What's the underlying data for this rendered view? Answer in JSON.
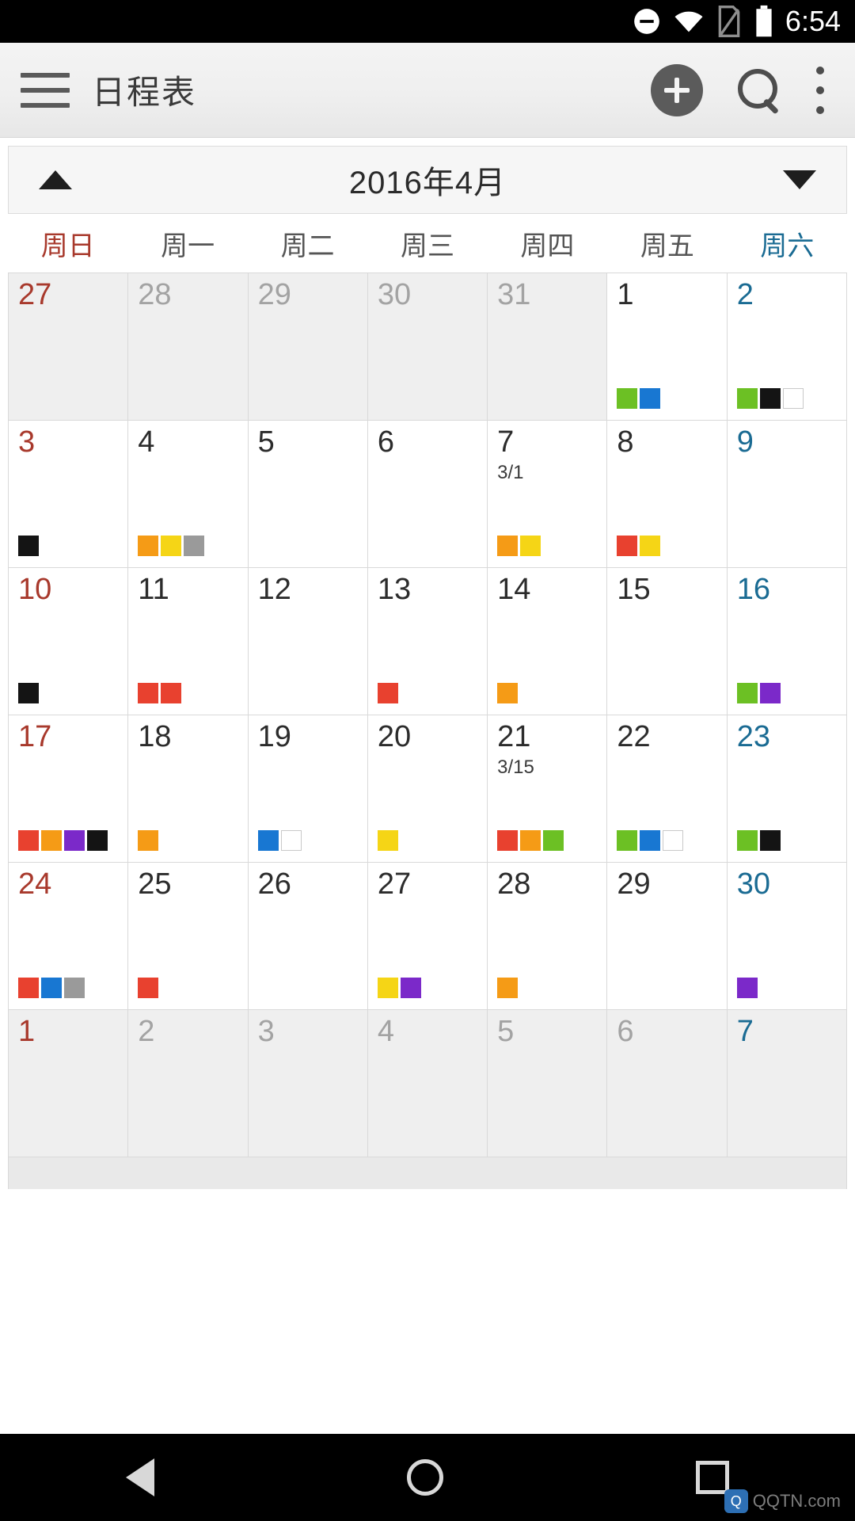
{
  "status_bar": {
    "time": "6:54",
    "icons": [
      "do-not-disturb-icon",
      "wifi-icon",
      "sim-card-icon",
      "battery-icon"
    ]
  },
  "app_bar": {
    "title": "日程表",
    "menu_icon": "hamburger-menu-icon",
    "add_label": "+",
    "search_icon": "search-icon",
    "overflow_icon": "more-vertical-icon"
  },
  "month_switcher": {
    "prev_icon": "triangle-up-icon",
    "next_icon": "triangle-down-icon",
    "label": "2016年4月"
  },
  "weekdays": [
    "周日",
    "周一",
    "周二",
    "周三",
    "周四",
    "周五",
    "周六"
  ],
  "colors": {
    "sunday": "#a8392c",
    "saturday": "#1a6b93",
    "red": "#e8412f",
    "orange": "#f59b16",
    "yellow": "#f5d516",
    "green": "#6cc024",
    "blue": "#1877d2",
    "purple": "#7b29c9",
    "gray": "#9a9a9a",
    "black": "#141414",
    "empty": "#ffffff"
  },
  "weeks": [
    [
      {
        "day": "27",
        "dim": true,
        "chips": []
      },
      {
        "day": "28",
        "dim": true,
        "chips": []
      },
      {
        "day": "29",
        "dim": true,
        "chips": []
      },
      {
        "day": "30",
        "dim": true,
        "chips": []
      },
      {
        "day": "31",
        "dim": true,
        "chips": []
      },
      {
        "day": "1",
        "dim": false,
        "chips": [
          "green",
          "blue"
        ]
      },
      {
        "day": "2",
        "dim": false,
        "chips": [
          "green",
          "black",
          "empty"
        ]
      }
    ],
    [
      {
        "day": "3",
        "dim": false,
        "chips": [
          "black"
        ]
      },
      {
        "day": "4",
        "dim": false,
        "chips": [
          "orange",
          "yellow",
          "gray"
        ]
      },
      {
        "day": "5",
        "dim": false,
        "chips": []
      },
      {
        "day": "6",
        "dim": false,
        "chips": []
      },
      {
        "day": "7",
        "dim": false,
        "lunar": "3/1",
        "chips": [
          "orange",
          "yellow"
        ]
      },
      {
        "day": "8",
        "dim": false,
        "chips": [
          "red",
          "yellow"
        ]
      },
      {
        "day": "9",
        "dim": false,
        "chips": []
      }
    ],
    [
      {
        "day": "10",
        "dim": false,
        "chips": [
          "black"
        ]
      },
      {
        "day": "11",
        "dim": false,
        "chips": [
          "red",
          "red"
        ]
      },
      {
        "day": "12",
        "dim": false,
        "chips": []
      },
      {
        "day": "13",
        "dim": false,
        "chips": [
          "red"
        ]
      },
      {
        "day": "14",
        "dim": false,
        "chips": [
          "orange"
        ]
      },
      {
        "day": "15",
        "dim": false,
        "chips": []
      },
      {
        "day": "16",
        "dim": false,
        "chips": [
          "green",
          "purple"
        ]
      }
    ],
    [
      {
        "day": "17",
        "dim": false,
        "chips": [
          "red",
          "orange",
          "purple",
          "black"
        ]
      },
      {
        "day": "18",
        "dim": false,
        "chips": [
          "orange"
        ]
      },
      {
        "day": "19",
        "dim": false,
        "chips": [
          "blue",
          "empty"
        ]
      },
      {
        "day": "20",
        "dim": false,
        "chips": [
          "yellow"
        ]
      },
      {
        "day": "21",
        "dim": false,
        "lunar": "3/15",
        "chips": [
          "red",
          "orange",
          "green"
        ]
      },
      {
        "day": "22",
        "dim": false,
        "chips": [
          "green",
          "blue",
          "empty"
        ]
      },
      {
        "day": "23",
        "dim": false,
        "chips": [
          "green",
          "black"
        ]
      }
    ],
    [
      {
        "day": "24",
        "dim": false,
        "chips": [
          "red",
          "blue",
          "gray"
        ]
      },
      {
        "day": "25",
        "dim": false,
        "chips": [
          "red"
        ]
      },
      {
        "day": "26",
        "dim": false,
        "chips": []
      },
      {
        "day": "27",
        "dim": false,
        "chips": [
          "yellow",
          "purple"
        ]
      },
      {
        "day": "28",
        "dim": false,
        "chips": [
          "orange"
        ]
      },
      {
        "day": "29",
        "dim": false,
        "chips": []
      },
      {
        "day": "30",
        "dim": false,
        "chips": [
          "purple"
        ]
      }
    ],
    [
      {
        "day": "1",
        "dim": true,
        "chips": []
      },
      {
        "day": "2",
        "dim": true,
        "chips": []
      },
      {
        "day": "3",
        "dim": true,
        "chips": []
      },
      {
        "day": "4",
        "dim": true,
        "chips": []
      },
      {
        "day": "5",
        "dim": true,
        "chips": []
      },
      {
        "day": "6",
        "dim": true,
        "chips": []
      },
      {
        "day": "7",
        "dim": true,
        "chips": []
      }
    ]
  ],
  "nav_bar": {
    "back_icon": "back-triangle-icon",
    "home_icon": "home-circle-icon",
    "recents_icon": "recents-square-icon"
  },
  "watermark": {
    "badge": "Q",
    "text": "QQTN.com"
  }
}
